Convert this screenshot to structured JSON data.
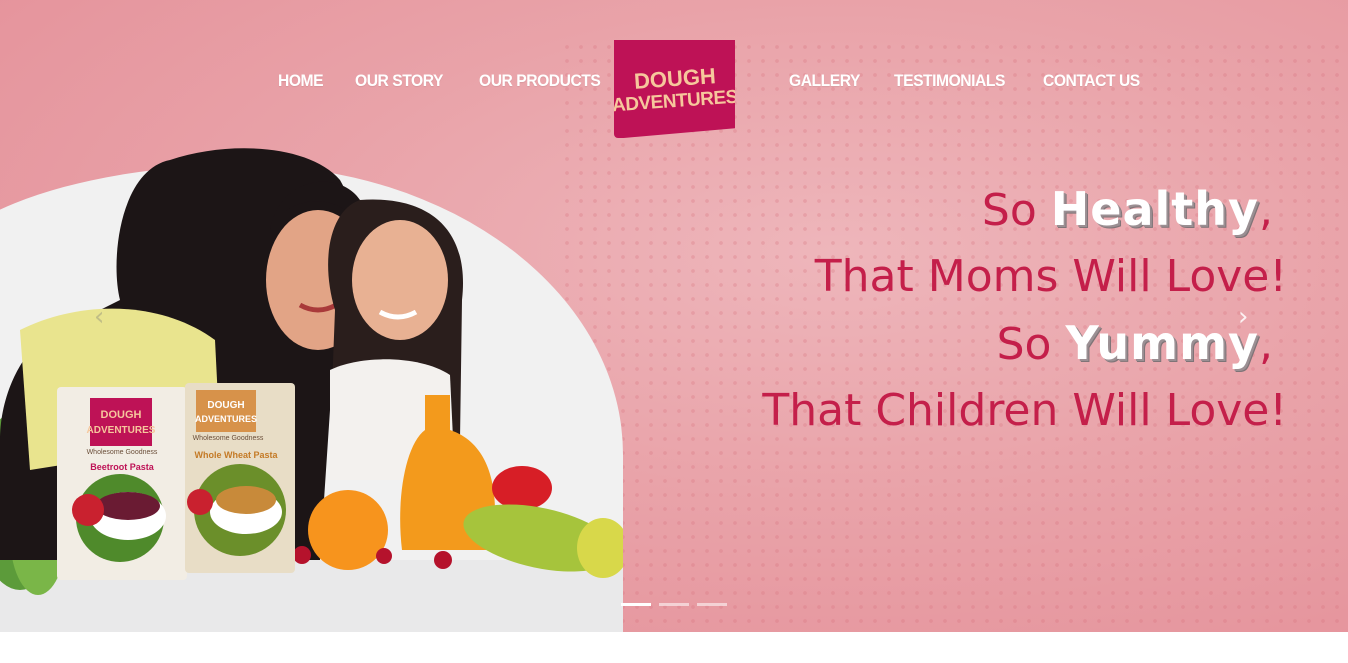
{
  "nav": {
    "left": [
      "HOME",
      "OUR STORY",
      "OUR PRODUCTS"
    ],
    "right": [
      "GALLERY",
      "TESTIMONIALS",
      "CONTACT US"
    ]
  },
  "logo": {
    "line1": "DOUGH",
    "line2": "ADVENTURES"
  },
  "hero": {
    "line1_prefix": "So",
    "line1_accent": "Healthy",
    "line1_suffix": ",",
    "line2": "That Moms Will Love!",
    "line3_prefix": "So",
    "line3_accent": "Yummy",
    "line3_suffix": ",",
    "line4": "That Children Will Love!"
  },
  "carousel": {
    "slides": 3,
    "active": 1
  },
  "products": {
    "pack1": {
      "brand_line1": "DOUGH",
      "brand_line2": "ADVENTURES",
      "tagline": "Wholesome Goodness",
      "name": "Beetroot Pasta"
    },
    "pack2": {
      "brand_line1": "DOUGH",
      "brand_line2": "ADVENTURES",
      "tagline": "Wholesome Goodness",
      "name": "Whole Wheat Pasta"
    }
  },
  "colors": {
    "accent": "#c41f4a",
    "logo_bg": "#be1256",
    "hero_bg": "#e9a3a9"
  }
}
